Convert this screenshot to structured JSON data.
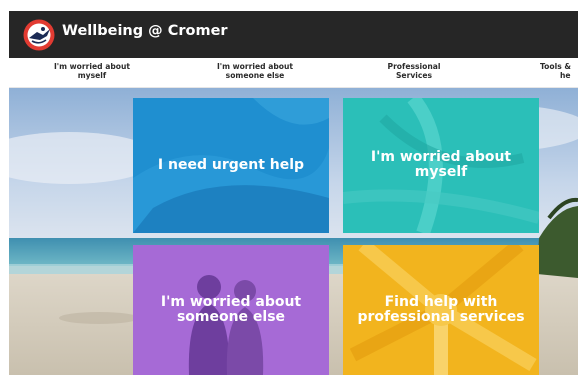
{
  "header": {
    "site_title": "Wellbeing @ Cromer",
    "logo_icon": "school-crest-logo"
  },
  "nav": {
    "items": [
      {
        "line1": "I'm worried about",
        "line2": "myself"
      },
      {
        "line1": "I'm worried about",
        "line2": "someone else"
      },
      {
        "line1": "Professional",
        "line2": "Services"
      },
      {
        "line1": "Tools &",
        "line2": "he"
      }
    ]
  },
  "tiles": [
    {
      "line1": "I need urgent help",
      "line2": "",
      "color": "#1f8fd0"
    },
    {
      "line1": "I'm worried about",
      "line2": "myself",
      "color": "#2bbfb8"
    },
    {
      "line1": "I'm worried about",
      "line2": "someone else",
      "color": "#a66ad6"
    },
    {
      "line1": "Find help with",
      "line2": "professional services",
      "color": "#f2b41e"
    }
  ],
  "colors": {
    "topbar": "#262626",
    "nav_bg": "#ffffff",
    "nav_text": "#2b2b2b"
  }
}
